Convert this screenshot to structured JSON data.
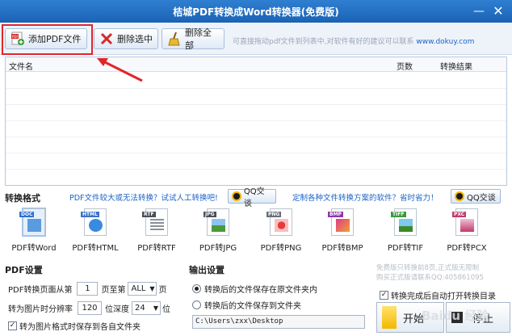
{
  "window": {
    "title": "桔城PDF转换成Word转换器(免费版)",
    "min_label": "—",
    "close_label": "✕"
  },
  "toolbar": {
    "add_label": "添加PDF文件",
    "delete_selected_label": "删除选中",
    "delete_all_label": "删除全部",
    "hint": "可直接拖动pdf文件到列表中,对软件有好的建议可以联系",
    "hint_url": "www.dokuy.com"
  },
  "file_list": {
    "columns": [
      "文件名",
      "页数",
      "转换结果"
    ],
    "rows": []
  },
  "format_section": {
    "label": "转换格式",
    "ask1": "PDF文件较大或无法转换？试试人工转换吧!",
    "qq1": "QQ交谈",
    "ask2": "定制各种文件转换方案的软件？省时省力！",
    "qq2": "QQ交谈",
    "formats": [
      {
        "tag": "DOC",
        "label": "PDF转Word",
        "tag_color": "#2a6fd1",
        "selected": true
      },
      {
        "tag": "HTML",
        "label": "PDF转HTML",
        "tag_color": "#3a72c8",
        "selected": false
      },
      {
        "tag": "RTF",
        "label": "PDF转RTF",
        "tag_color": "#4a4f56",
        "selected": false
      },
      {
        "tag": "JPG",
        "label": "PDF转JPG",
        "tag_color": "#4a4f56",
        "selected": false
      },
      {
        "tag": "PNG",
        "label": "PDF转PNG",
        "tag_color": "#6a6f76",
        "selected": false
      },
      {
        "tag": "BMP",
        "label": "PDF转BMP",
        "tag_color": "#8a3aa8",
        "selected": false
      },
      {
        "tag": "TIFF",
        "label": "PDF转TIF",
        "tag_color": "#3a9a3a",
        "selected": false
      },
      {
        "tag": "PXC",
        "label": "PDF转PCX",
        "tag_color": "#c23a6a",
        "selected": false
      }
    ]
  },
  "pdf_settings": {
    "label": "PDF设置",
    "page_from_label": "PDF转换页面从第",
    "page_from_value": "1",
    "page_to_label": "页至第",
    "page_to_value": "ALL",
    "page_unit": "页",
    "dpi_label": "转为图片时分辨率",
    "dpi_value": "120",
    "depth_label": "位深度",
    "depth_value": "24",
    "depth_unit": "位",
    "save_sep_label": "转为图片格式时保存到各自文件夹",
    "save_sep_checked": true
  },
  "output_settings": {
    "label": "输出设置",
    "option1": "转换后的文件保存在原文件夹内",
    "option2": "转换后的文件保存到文件夹",
    "selected": 1,
    "path": "C:\\Users\\zxx\\Desktop"
  },
  "right_panel": {
    "promo_line1": "免费版只转换前8页,正式版无限制",
    "promo_line2": "购买正式版请联系QQ:405861095",
    "open_dir_label": "转换完成后自动打开转换目录",
    "open_dir_checked": true,
    "start_label": "开始",
    "stop_label": "停止",
    "watermark": "Baidu 经验"
  },
  "colors": {
    "titlebar": "#1b62b5",
    "highlight_box": "#e0262b",
    "link": "#1a63c6"
  }
}
